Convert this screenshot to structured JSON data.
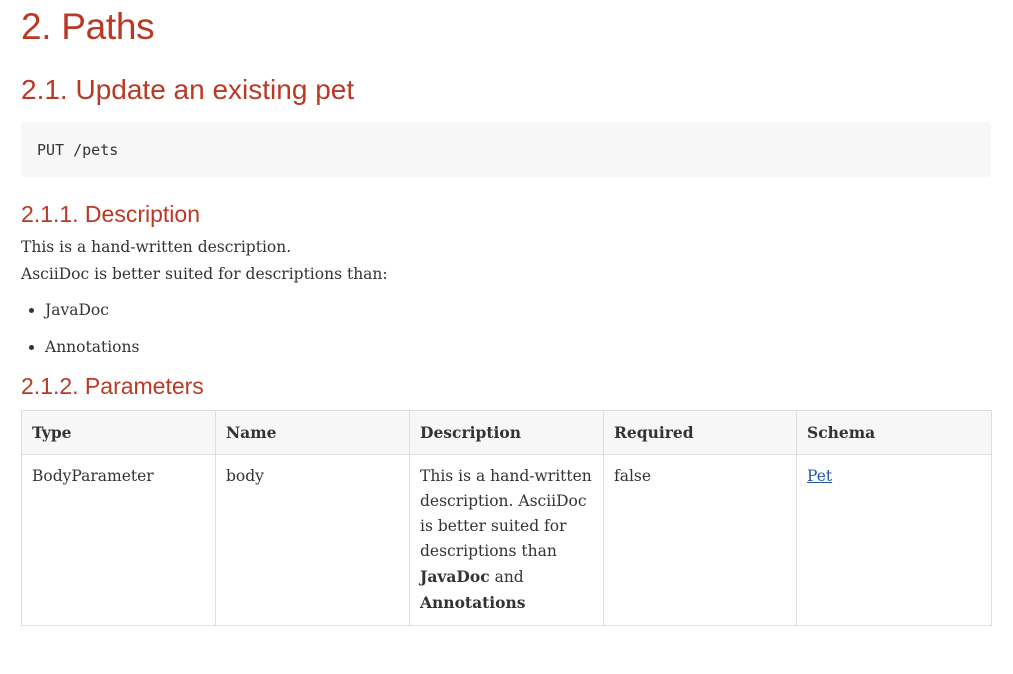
{
  "section": {
    "title": "2. Paths"
  },
  "operation": {
    "title": "2.1. Update an existing pet",
    "request": "PUT /pets"
  },
  "description": {
    "heading": "2.1.1. Description",
    "line1": "This is a hand-written description.",
    "line2": "AsciiDoc is better suited for descriptions than:",
    "bullets": [
      "JavaDoc",
      "Annotations"
    ]
  },
  "parameters": {
    "heading": "2.1.2. Parameters",
    "columns": [
      "Type",
      "Name",
      "Description",
      "Required",
      "Schema"
    ],
    "rows": [
      {
        "type": "BodyParameter",
        "name": "body",
        "description_text": "This is a hand-written description. AsciiDoc is better suited for descriptions than ",
        "description_bold1": "JavaDoc",
        "description_and": " and ",
        "description_bold2": "Annotations",
        "required": "false",
        "schema": "Pet"
      }
    ]
  },
  "colors": {
    "heading": "#ba3925",
    "text": "#333333",
    "link": "#2156a5",
    "listing_bg": "#f7f7f8",
    "table_border": "#dedede"
  }
}
